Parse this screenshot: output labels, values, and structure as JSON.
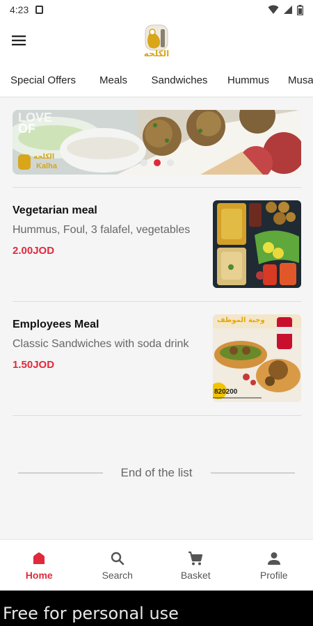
{
  "status_bar": {
    "time": "4:23",
    "icons": [
      "sim-card-icon",
      "wifi-icon",
      "signal-icon",
      "battery-icon"
    ]
  },
  "app_bar": {
    "menu_icon": "hamburger-menu-icon",
    "logo_text": "الكلحه"
  },
  "tabs": [
    {
      "label": "Special Offers",
      "active": true
    },
    {
      "label": "Meals",
      "active": false
    },
    {
      "label": "Sandwiches",
      "active": false
    },
    {
      "label": "Hummus",
      "active": false
    },
    {
      "label": "Musa",
      "active": false
    }
  ],
  "banner": {
    "overlay_text_1": "LOVE",
    "overlay_text_2": "OF",
    "brand_ar": "الكلحه",
    "brand_en": "Kalha",
    "dots": [
      false,
      true,
      false
    ]
  },
  "items": [
    {
      "title": "Vegetarian meal",
      "description": "Hummus, Foul, 3 falafel, vegetables",
      "price": "2.00JOD"
    },
    {
      "title": "Employees Meal",
      "description": "Classic Sandwiches with soda drink",
      "price": "1.50JOD",
      "image_text_ar": "وجبة الموظف",
      "image_phone": "820200"
    }
  ],
  "end_of_list": "End of the list",
  "bottom_nav": [
    {
      "label": "Home",
      "icon": "home-icon",
      "active": true
    },
    {
      "label": "Search",
      "icon": "search-icon",
      "active": false
    },
    {
      "label": "Basket",
      "icon": "cart-icon",
      "active": false
    },
    {
      "label": "Profile",
      "icon": "person-icon",
      "active": false
    }
  ],
  "watermark": "Free for personal use",
  "colors": {
    "accent": "#e0293a",
    "logo_gold": "#d9a61a"
  }
}
